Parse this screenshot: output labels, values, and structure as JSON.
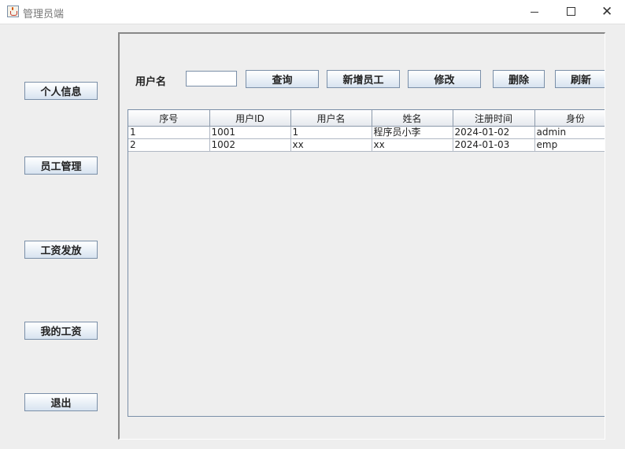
{
  "window": {
    "title": "管理员端",
    "close_glyph": "✕"
  },
  "sidebar": {
    "items": [
      {
        "label": "个人信息"
      },
      {
        "label": "员工管理"
      },
      {
        "label": "工资发放"
      },
      {
        "label": "我的工资"
      },
      {
        "label": "退出"
      }
    ]
  },
  "toolbar": {
    "search_label": "用户名",
    "search_value": "",
    "query_label": "查询",
    "add_label": "新增员工",
    "edit_label": "修改",
    "delete_label": "删除",
    "refresh_label": "刷新"
  },
  "table": {
    "columns": [
      "序号",
      "用户ID",
      "用户名",
      "姓名",
      "注册时间",
      "身份"
    ],
    "rows": [
      [
        "1",
        "1001",
        "1",
        "程序员小李",
        "2024-01-02",
        "admin"
      ],
      [
        "2",
        "1002",
        "xx",
        "xx",
        "2024-01-03",
        "emp"
      ]
    ]
  }
}
